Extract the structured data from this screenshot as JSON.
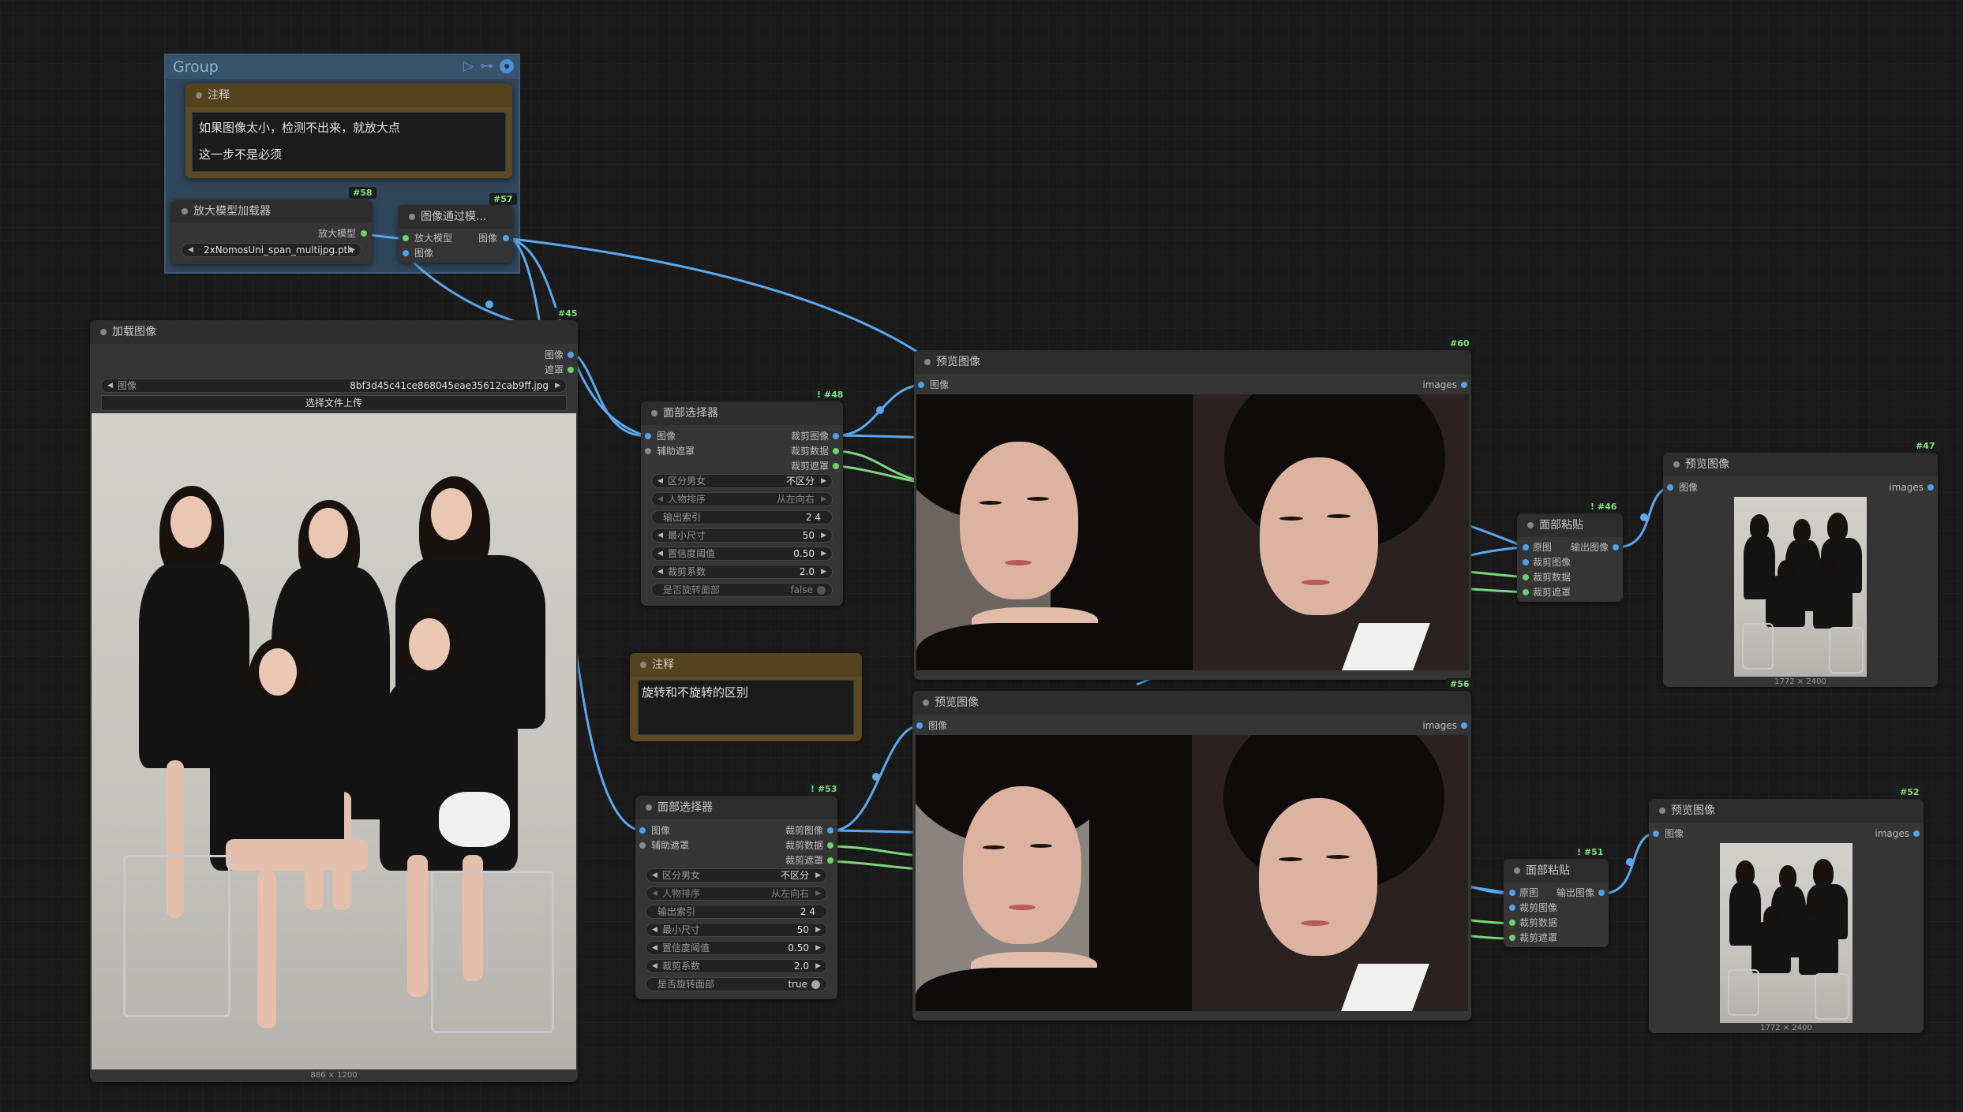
{
  "group": {
    "title": "Group"
  },
  "note1": {
    "title": "注释",
    "lines": [
      "如果图像太小，检测不出来，就放大点",
      "这一步不是必须"
    ]
  },
  "upscale_loader": {
    "id": "#58",
    "title": "放大模型加载器",
    "output_label": "放大模型",
    "model_value": "2xNomosUni_span_multijpg.pth"
  },
  "upscale_image": {
    "id": "#57",
    "title": "图像通过模...",
    "input_model": "放大模型",
    "input_image": "图像",
    "output_image": "图像"
  },
  "load_image": {
    "id": "#45",
    "title": "加载图像",
    "output_image": "图像",
    "output_mask": "遮罩",
    "image_label": "图像",
    "image_value": "8bf3d45c41ce868045eae35612cab9ff.jpg",
    "upload_label": "选择文件上传",
    "dims": "886 × 1200"
  },
  "face_selector_1": {
    "id": "! #48",
    "title": "面部选择器",
    "inputs": [
      "图像",
      "辅助遮罩"
    ],
    "outputs": [
      "裁剪图像",
      "裁剪数据",
      "裁剪遮罩"
    ],
    "widgets": [
      {
        "label": "区分男女",
        "value": "不区分"
      },
      {
        "label": "人物排序",
        "value": "从左向右"
      },
      {
        "label": "输出索引",
        "value": "2 4"
      },
      {
        "label": "最小尺寸",
        "value": "50"
      },
      {
        "label": "置信度阈值",
        "value": "0.50"
      },
      {
        "label": "裁剪系数",
        "value": "2.0"
      },
      {
        "label": "是否旋转面部",
        "value": "false"
      }
    ]
  },
  "face_selector_2": {
    "id": "! #53",
    "title": "面部选择器",
    "inputs": [
      "图像",
      "辅助遮罩"
    ],
    "outputs": [
      "裁剪图像",
      "裁剪数据",
      "裁剪遮罩"
    ],
    "widgets": [
      {
        "label": "区分男女",
        "value": "不区分"
      },
      {
        "label": "人物排序",
        "value": "从左向右"
      },
      {
        "label": "输出索引",
        "value": "2 4"
      },
      {
        "label": "最小尺寸",
        "value": "50"
      },
      {
        "label": "置信度阈值",
        "value": "0.50"
      },
      {
        "label": "裁剪系数",
        "value": "2.0"
      },
      {
        "label": "是否旋转面部",
        "value": "true"
      }
    ]
  },
  "note2": {
    "title": "注释",
    "text": "旋转和不旋转的区别"
  },
  "preview_60": {
    "id": "#60",
    "title": "预览图像",
    "input": "图像",
    "output": "images"
  },
  "preview_56": {
    "id": "#56",
    "title": "预览图像",
    "input": "图像",
    "output": "images"
  },
  "face_paste_1": {
    "id": "! #46",
    "title": "面部粘贴",
    "inputs": [
      "原图",
      "裁剪图像",
      "裁剪数据",
      "裁剪遮罩"
    ],
    "output": "输出图像"
  },
  "face_paste_2": {
    "id": "! #51",
    "title": "面部粘贴",
    "inputs": [
      "原图",
      "裁剪图像",
      "裁剪数据",
      "裁剪遮罩"
    ],
    "output": "输出图像"
  },
  "preview_47": {
    "id": "#47",
    "title": "预览图像",
    "input": "图像",
    "output": "images",
    "dims": "1772 × 2400"
  },
  "preview_52": {
    "id": "#52",
    "title": "预览图像",
    "input": "图像",
    "output": "images",
    "dims": "1772 × 2400"
  },
  "colors": {
    "link_blue": "#5aa9f0",
    "link_green": "#7fd87f",
    "group_bg": "#30465a",
    "note_bg": "#5c4a24"
  }
}
